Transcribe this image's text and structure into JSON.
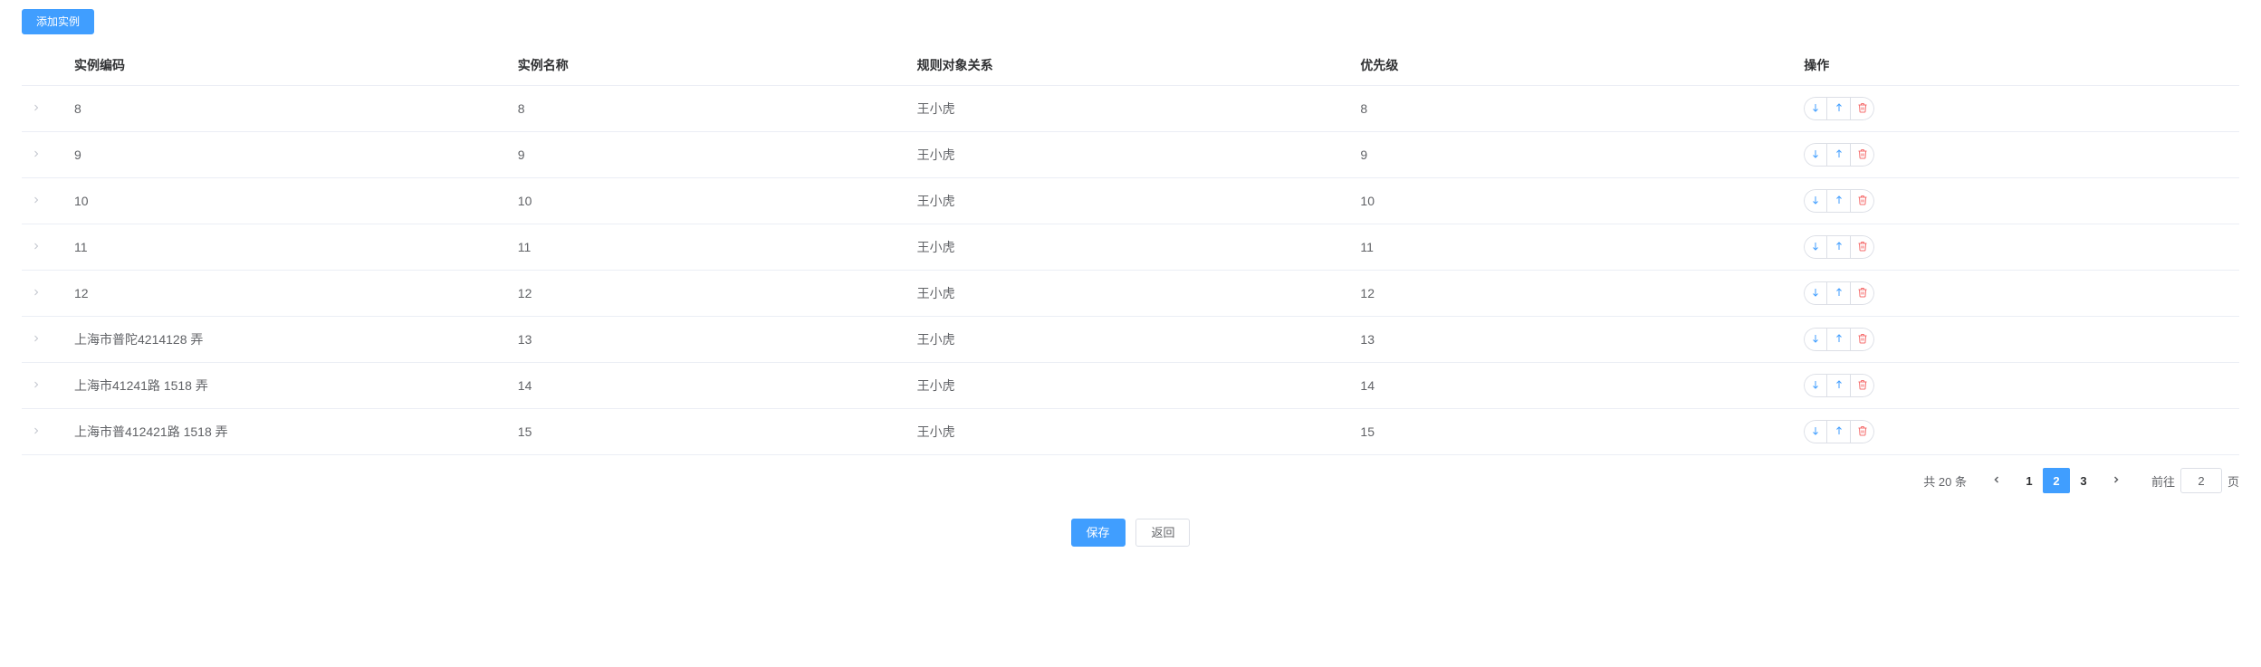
{
  "toolbar": {
    "add_label": "添加实例"
  },
  "table": {
    "headers": {
      "code": "实例编码",
      "name": "实例名称",
      "relation": "规则对象关系",
      "priority": "优先级",
      "action": "操作"
    },
    "rows": [
      {
        "code": "8",
        "name": "8",
        "relation": "王小虎",
        "priority": "8"
      },
      {
        "code": "9",
        "name": "9",
        "relation": "王小虎",
        "priority": "9"
      },
      {
        "code": "10",
        "name": "10",
        "relation": "王小虎",
        "priority": "10"
      },
      {
        "code": "11",
        "name": "11",
        "relation": "王小虎",
        "priority": "11"
      },
      {
        "code": "12",
        "name": "12",
        "relation": "王小虎",
        "priority": "12"
      },
      {
        "code": "上海市普陀4214128 弄",
        "name": "13",
        "relation": "王小虎",
        "priority": "13"
      },
      {
        "code": "上海市41241路 1518 弄",
        "name": "14",
        "relation": "王小虎",
        "priority": "14"
      },
      {
        "code": "上海市普412421路 1518 弄",
        "name": "15",
        "relation": "王小虎",
        "priority": "15"
      }
    ]
  },
  "pagination": {
    "total_text": "共 20 条",
    "pages": [
      "1",
      "2",
      "3"
    ],
    "current": "2",
    "jump_prefix": "前往",
    "jump_value": "2",
    "jump_suffix": "页"
  },
  "footer": {
    "save_label": "保存",
    "back_label": "返回"
  }
}
